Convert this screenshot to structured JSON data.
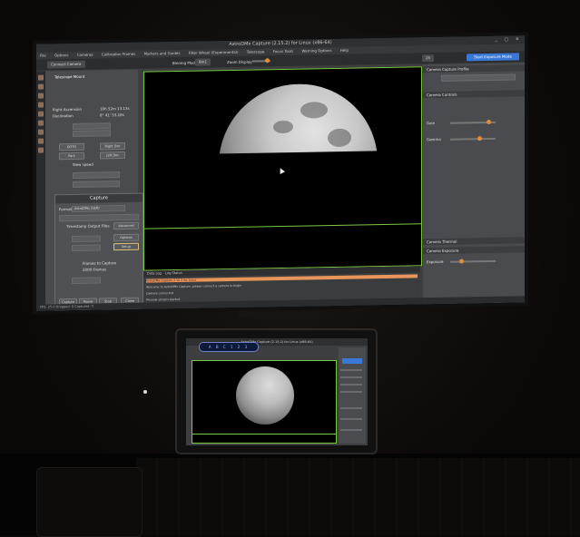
{
  "monitor_app": {
    "title": "AstroDMx Capture (2.15.2) for Linux (x86-64)",
    "menu": [
      "File",
      "Options",
      "Cameras",
      "Calibration Frames",
      "Markers and Guides",
      "Filter Wheel (Experimental)",
      "Telescope",
      "Focus Tools",
      "Warning Options",
      "Help"
    ],
    "toolbar": {
      "connect": "Connect Camera",
      "binning_label": "Binning Mode:",
      "binning_value": "Bin1",
      "zoom_label": "Zoom Display:",
      "fps": "25",
      "start_button": "Start Exposure Mode"
    },
    "left_panel": {
      "section": "Capture",
      "mount_title": "Telescope Mount",
      "ra_label": "Right Ascension",
      "dec_label": "Declination",
      "ra_value": "10h 52m 13.13s",
      "dec_value": "8° 41' 53.18s",
      "goto_label": "GOTO",
      "park_label": "Park",
      "rates": [
        "Right Dec",
        "Left Dec"
      ],
      "speed_label": "Slew speed",
      "capture_title": "Capture",
      "format_label": "Format:",
      "format_value": "AstroDMx (SER)",
      "timestamp_label": "Timestamp Output Files",
      "advanced_label": "Advanced",
      "frame_label": "Frames to Capture",
      "frames": "2000 Frames",
      "options_label": "Options",
      "setup_label": "Setup",
      "start_label": "Capture",
      "pause_label": "Pause",
      "stop_label": "Stop",
      "close_label": "Close"
    },
    "right_panel": {
      "sections": [
        "Camera Capture Profile",
        "Camera Controls",
        "Camera Thermal",
        "Camera Exposure"
      ],
      "exposure_label": "Exposure",
      "gain_label": "Gain",
      "gamma_label": "Gamma"
    },
    "log": {
      "tabs": [
        "Data Log",
        "Log Status"
      ],
      "lines": [
        "AstroDMx Capture 2.15.2 for Linux",
        "Welcome to AstroDMx Capture, please connect a camera to begin",
        "Camera connected",
        "Preview stream started"
      ]
    },
    "status": "FPS: 25.0   Dropped: 0   Captured: 0"
  },
  "tablet_app": {
    "title": "AstroDMx Capture (2.15.2) for Linux (x86-64)",
    "kbd_text": "A B C 1 2 3"
  },
  "colors": {
    "accent": "#3a78d8",
    "roi": "#7ac943",
    "highlight": "#e8945a"
  }
}
